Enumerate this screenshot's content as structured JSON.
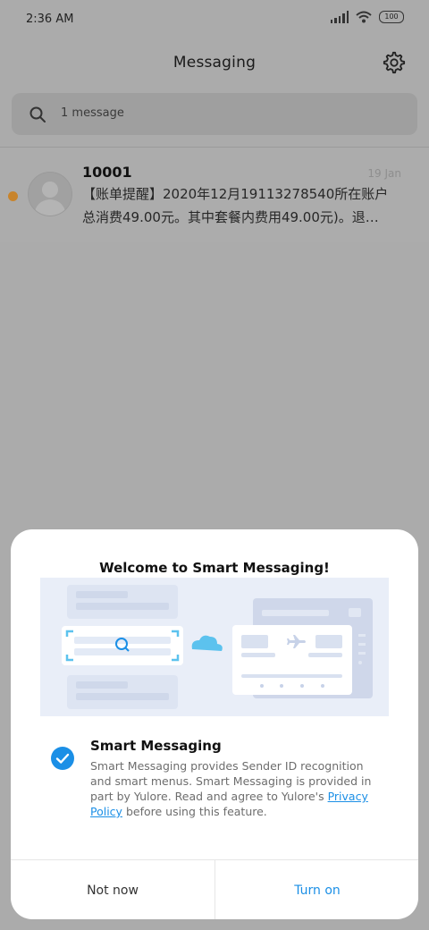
{
  "status_bar": {
    "time": "2:36 AM",
    "battery": "100"
  },
  "header": {
    "title": "Messaging",
    "settings_icon": "gear-icon"
  },
  "search": {
    "text": "1 message",
    "icon": "search-icon"
  },
  "threads": [
    {
      "sender": "10001",
      "date": "19 Jan",
      "preview": "【账单提醒】2020年12月19113278540所在账户总消费49.00元。其中套餐内费用49.00元)。退…",
      "unread": true
    }
  ],
  "dialog": {
    "title": "Welcome to Smart Messaging!",
    "option_title": "Smart Messaging",
    "desc_before": "Smart Messaging provides Sender ID recognition and smart menus. Smart Messaging is provided in part by Yulore. Read and agree to Yulore's ",
    "policy_link": "Privacy Policy",
    "desc_after": " before using this feature.",
    "checked": true,
    "not_now": "Not now",
    "turn_on": "Turn on"
  },
  "colors": {
    "accent": "#1b8fe6",
    "unread_dot": "#c8842c",
    "overlay_bg": "#ababab"
  }
}
